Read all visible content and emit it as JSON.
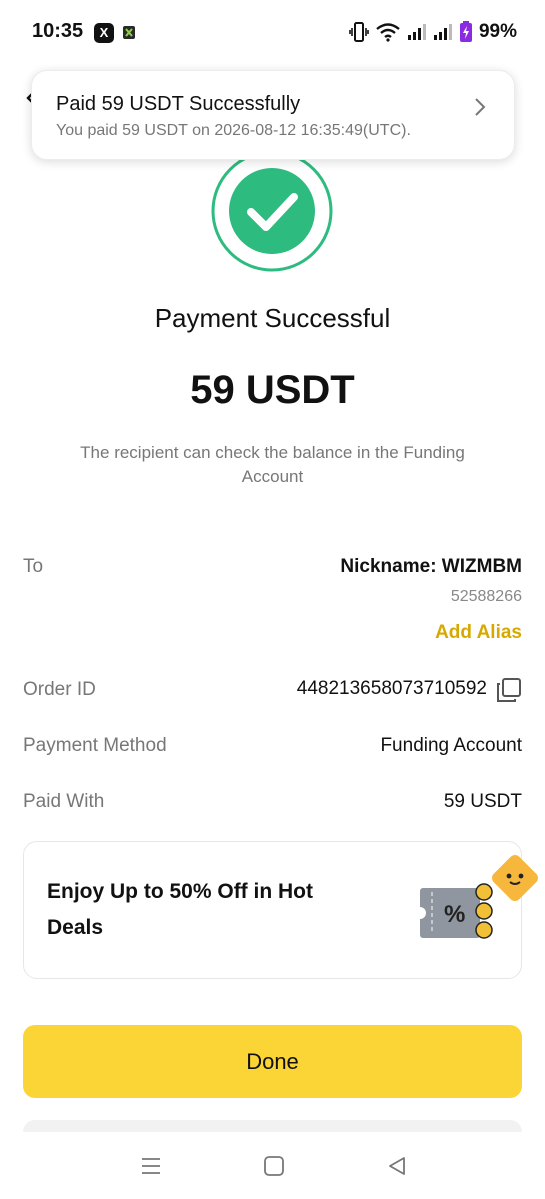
{
  "status_bar": {
    "time": "10:35",
    "x_app": "X",
    "battery": "99%",
    "icons": [
      "vibrate-icon",
      "wifi-icon",
      "signal-icon",
      "signal-icon",
      "battery-charging-icon"
    ]
  },
  "toast": {
    "title": "Paid 59 USDT Successfully",
    "subtitle": "You paid 59 USDT on 2026-08-12 16:35:49(UTC)."
  },
  "result": {
    "title": "Payment Successful",
    "amount": "59 USDT",
    "note": "The recipient can check the balance in the Funding Account"
  },
  "details": {
    "to_label": "To",
    "nickname": "Nickname: WIZMBM",
    "uid": "52588266",
    "add_alias": "Add Alias",
    "order_label": "Order ID",
    "order_id": "448213658073710592",
    "method_label": "Payment Method",
    "method_value": "Funding Account",
    "paid_label": "Paid With",
    "paid_value": "59 USDT"
  },
  "promo": {
    "text": "Enjoy Up to 50% Off in Hot Deals"
  },
  "actions": {
    "done": "Done"
  },
  "colors": {
    "accent": "#fbd535",
    "success": "#2dbb7f",
    "alias": "#d7a900"
  }
}
